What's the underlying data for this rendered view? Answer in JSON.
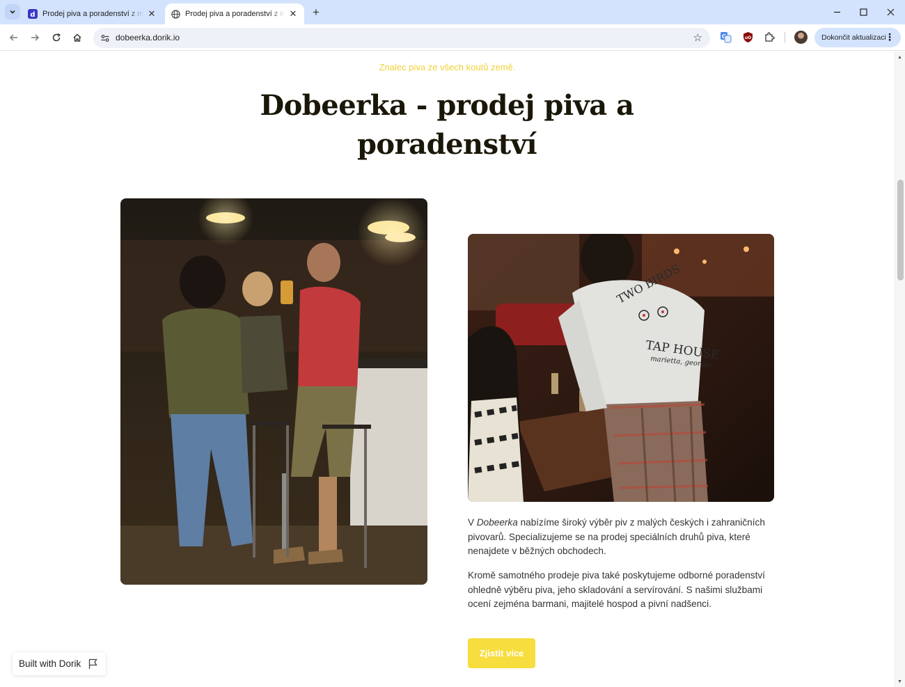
{
  "browser": {
    "tabs": [
      {
        "title": "Prodej piva a poradenství z malých pivovarů",
        "active": false,
        "favicon": "dorik-icon"
      },
      {
        "title": "Prodej piva a poradenství z malých pivovarů",
        "active": true,
        "favicon": "globe-icon"
      }
    ],
    "url": "dobeerka.dorik.io",
    "update_button": "Dokončit aktualizaci"
  },
  "page": {
    "tagline": "Znalec piva ze všech koutů země.",
    "heading": "Dobeerka - prodej piva a poradenství",
    "para1": {
      "lead": "V ",
      "brand": "Dobeerka",
      "rest": " nabízíme široký výběr piv z malých českých i zahraničních pivovarů. Specializujeme se na prodej speciálních druhů piva, které nenajdete v běžných obchodech."
    },
    "para2": "Kromě samotného prodeje piva také poskytujeme odborné poradenství ohledně výběru piva, jeho skladování a servírování. S našimi službami ocení zejména barmani, majitelé hospod a pivní nadšenci.",
    "cta_label": "Zjistit více",
    "badge_label": "Built with Dorik",
    "photo_right_shirt_text": [
      "TWO BIRDS",
      "TAP HOUSE",
      "marietta, georgia"
    ]
  },
  "colors": {
    "tagline": "#f1d236",
    "heading": "#1a1708",
    "cta_bg": "#f7dd3e",
    "tab_strip": "#d3e3fd"
  }
}
